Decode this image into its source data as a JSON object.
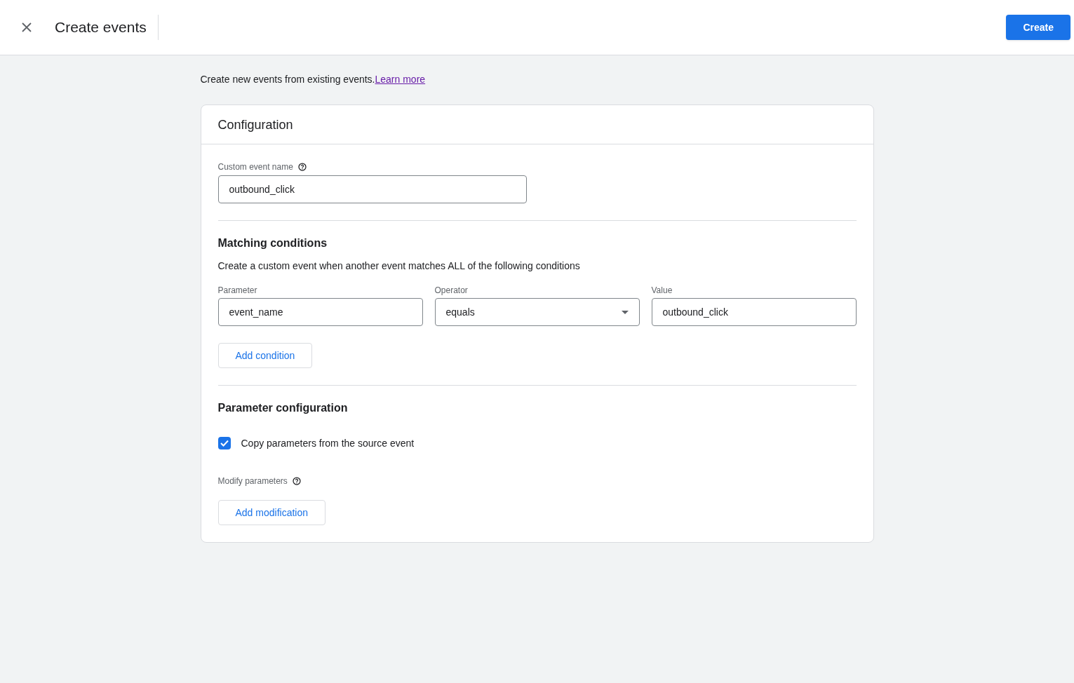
{
  "header": {
    "title": "Create events",
    "create_button": "Create"
  },
  "intro": {
    "text": "Create new events from existing events.",
    "link": "Learn more"
  },
  "configuration": {
    "title": "Configuration",
    "custom_event_name": {
      "label": "Custom event name",
      "value": "outbound_click"
    },
    "matching_conditions": {
      "title": "Matching conditions",
      "description": "Create a custom event when another event matches ALL of the following conditions",
      "fields": [
        {
          "kind": "text",
          "label": "Parameter",
          "value": "event_name"
        },
        {
          "kind": "select",
          "label": "Operator",
          "value": "equals"
        },
        {
          "kind": "text",
          "label": "Value",
          "value": "outbound_click"
        }
      ],
      "add_button": "Add condition"
    },
    "parameter_configuration": {
      "title": "Parameter configuration",
      "copy_checkbox": {
        "label": "Copy parameters from the source event",
        "checked": true
      },
      "modify_label": "Modify parameters",
      "add_button": "Add modification"
    }
  }
}
